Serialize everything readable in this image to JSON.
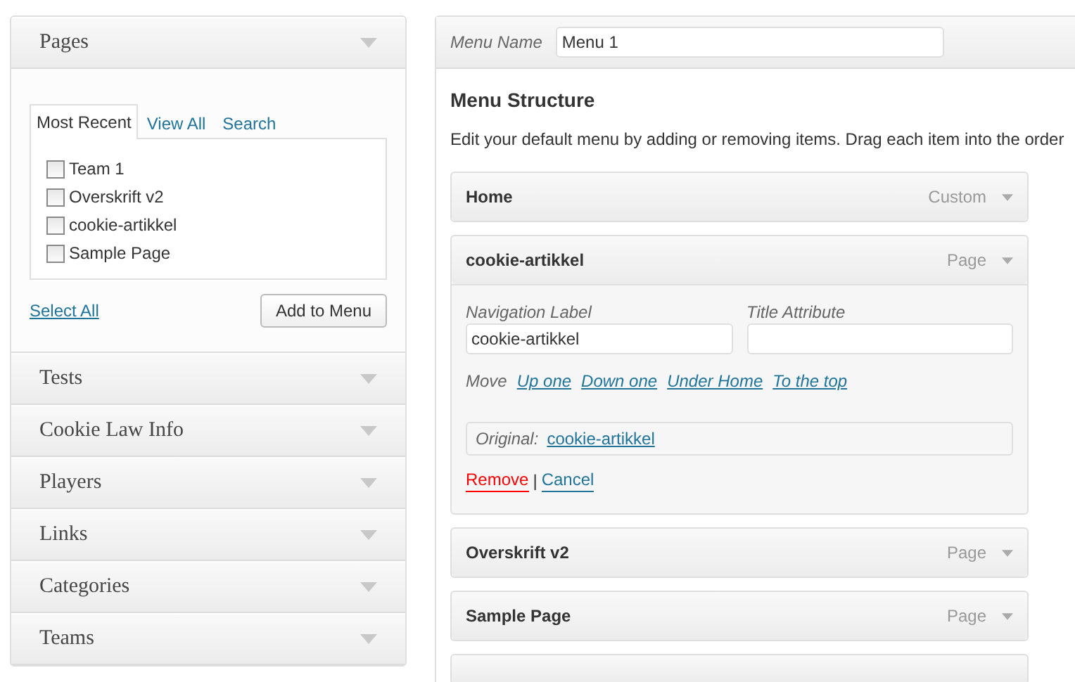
{
  "sidebar": {
    "sections": [
      {
        "title": "Pages",
        "expanded": true,
        "tabs": [
          {
            "label": "Most Recent",
            "selected": true
          },
          {
            "label": "View All",
            "selected": false
          },
          {
            "label": "Search",
            "selected": false
          }
        ],
        "items": [
          {
            "label": "Team 1",
            "checked": false
          },
          {
            "label": "Overskrift v2",
            "checked": false
          },
          {
            "label": "cookie-artikkel",
            "checked": false
          },
          {
            "label": "Sample Page",
            "checked": false
          }
        ],
        "select_all": "Select All",
        "add_button": "Add to Menu"
      },
      {
        "title": "Tests",
        "expanded": false
      },
      {
        "title": "Cookie Law Info",
        "expanded": false
      },
      {
        "title": "Players",
        "expanded": false
      },
      {
        "title": "Links",
        "expanded": false
      },
      {
        "title": "Categories",
        "expanded": false
      },
      {
        "title": "Teams",
        "expanded": false
      }
    ]
  },
  "menu": {
    "name_label": "Menu Name",
    "name_value": "Menu 1",
    "structure_title": "Menu Structure",
    "description": "Edit your default menu by adding or removing items. Drag each item into the order",
    "items": [
      {
        "title": "Home",
        "type": "Custom",
        "expanded": false
      },
      {
        "title": "cookie-artikkel",
        "type": "Page",
        "expanded": true,
        "nav_label_caption": "Navigation Label",
        "nav_label_value": "cookie-artikkel",
        "title_attr_caption": "Title Attribute",
        "move_label": "Move",
        "move_links": [
          "Up one",
          "Down one",
          "Under Home",
          "To the top"
        ],
        "original_label": "Original:",
        "original_link": "cookie-artikkel",
        "remove": "Remove",
        "separator": "|",
        "cancel": "Cancel"
      },
      {
        "title": "Overskrift v2",
        "type": "Page",
        "expanded": false
      },
      {
        "title": "Sample Page",
        "type": "Page",
        "expanded": false
      }
    ]
  }
}
